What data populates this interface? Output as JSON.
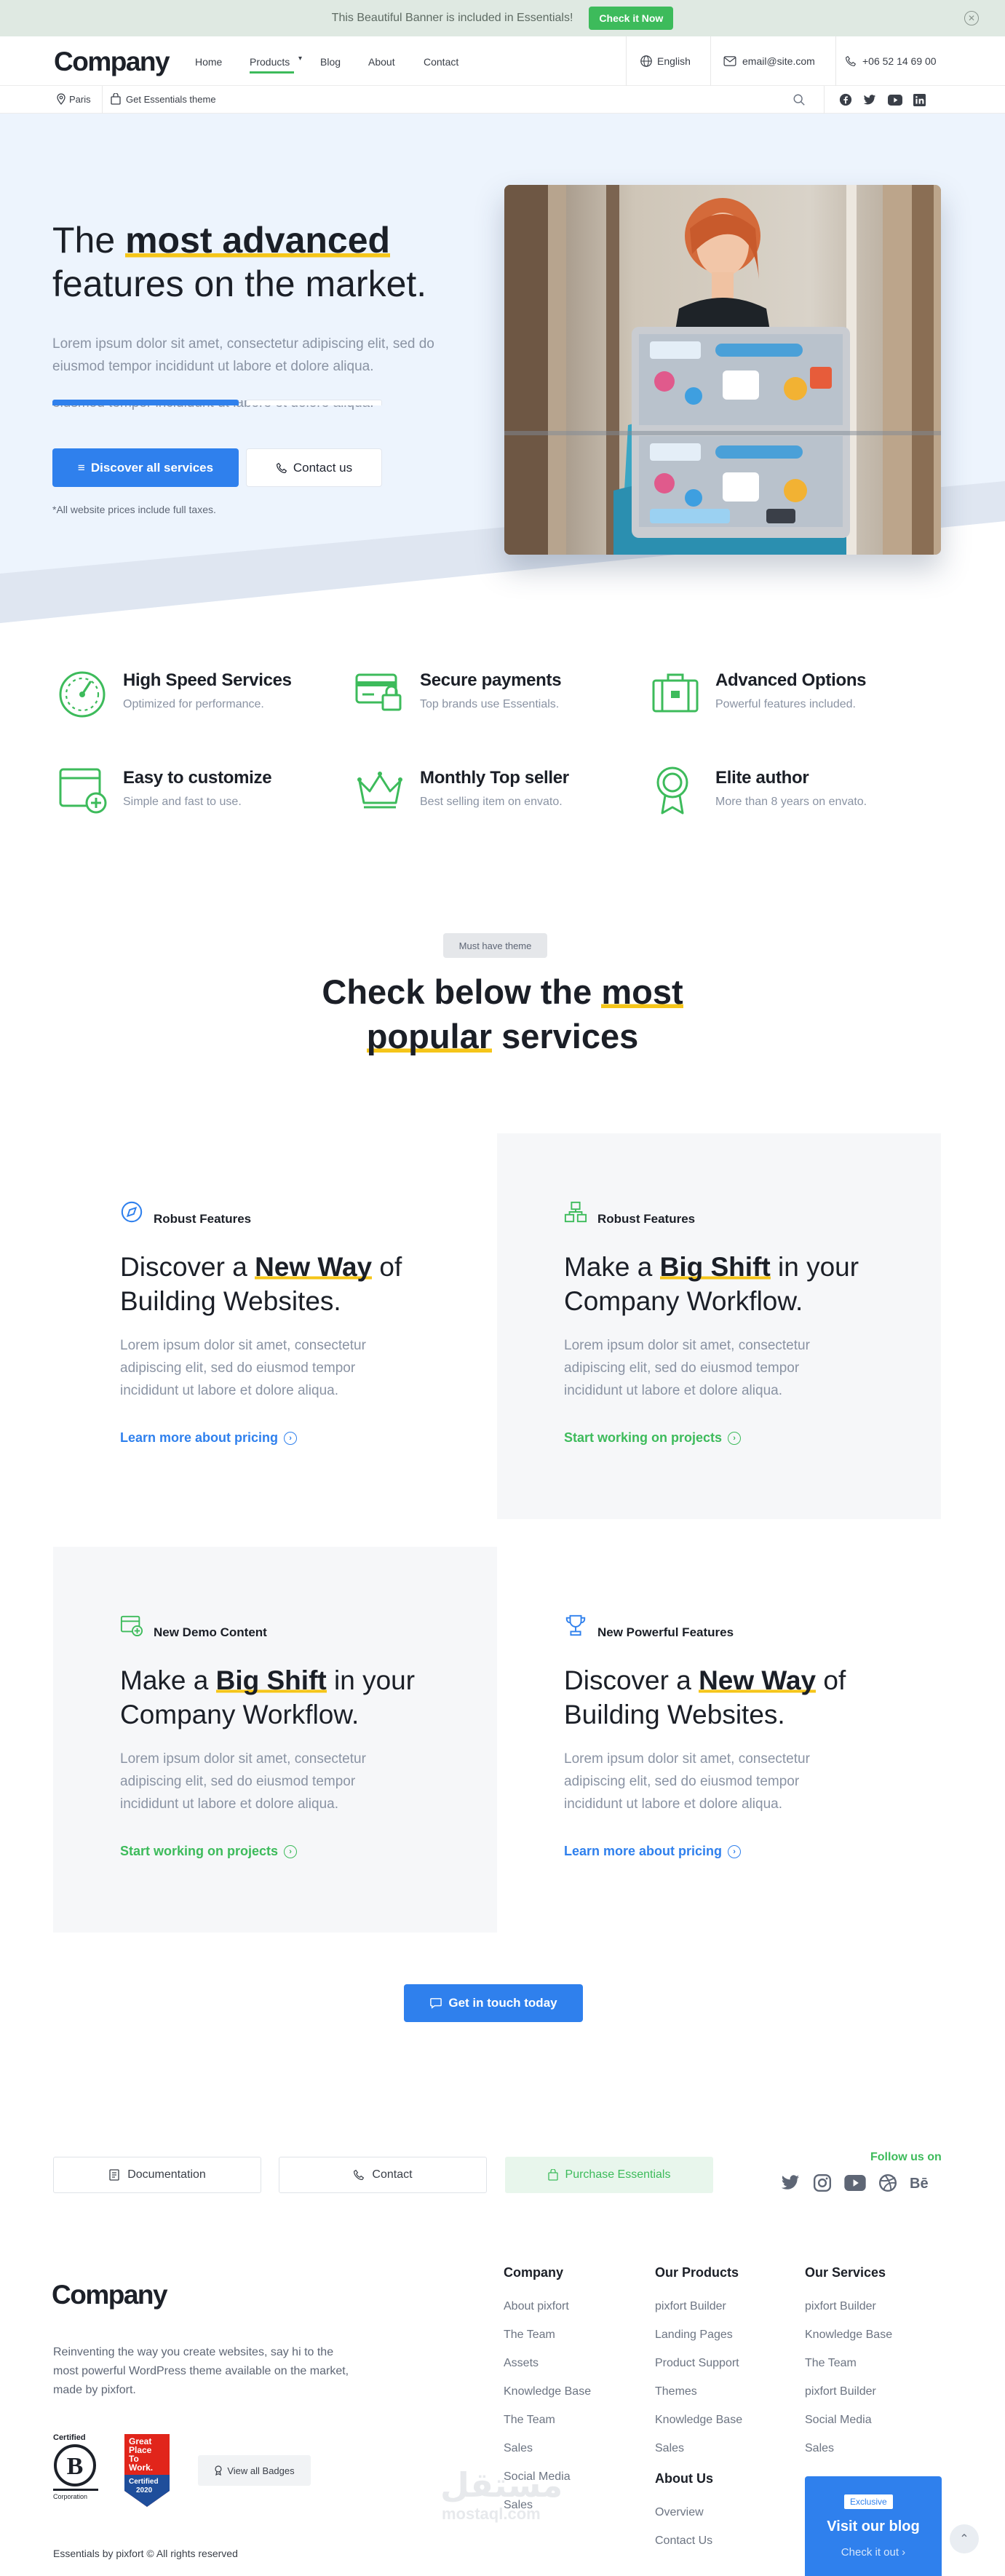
{
  "banner": {
    "text": "This Beautiful Banner is included in Essentials!",
    "cta": "Check it Now"
  },
  "brand": {
    "logo": "Company",
    "primary_color": "#2f80ed",
    "accent_green": "#3dbb5b",
    "highlight_yellow": "#f5c518"
  },
  "nav": {
    "home": "Home",
    "products": "Products",
    "blog": "Blog",
    "about": "About",
    "contact": "Contact"
  },
  "header": {
    "language": "English",
    "email": "email@site.com",
    "phone": "+06 52 14 69 00"
  },
  "subbar": {
    "location": "Paris",
    "theme": "Get Essentials theme"
  },
  "hero": {
    "title_pre": "The ",
    "title_highlight": "most advanced",
    "title_post": "features on the market.",
    "desc": "Lorem ipsum dolor sit amet, consectetur adipiscing elit, sed do eiusmod tempor incididunt ut labore et dolore aliqua.",
    "ghost_text": "eiusmod tempor incididunt ut labore et dolore aliqua.",
    "btn_primary": "Discover all services",
    "btn_secondary": "Contact us",
    "note": "*All website prices include full taxes."
  },
  "features": [
    {
      "title": "High Speed Services",
      "sub": "Optimized for performance.",
      "icon": "speedometer-icon"
    },
    {
      "title": "Secure payments",
      "sub": "Top brands use Essentials.",
      "icon": "credit-card-lock-icon"
    },
    {
      "title": "Advanced Options",
      "sub": "Powerful features included.",
      "icon": "toolbox-icon"
    },
    {
      "title": "Easy to customize",
      "sub": "Simple and fast to use.",
      "icon": "window-add-icon"
    },
    {
      "title": "Monthly Top seller",
      "sub": "Best selling item on envato.",
      "icon": "crown-icon"
    },
    {
      "title": "Elite author",
      "sub": "More than 8 years on envato.",
      "icon": "award-badge-icon"
    }
  ],
  "section": {
    "tag": "Must have theme",
    "title_pre": "Check below the ",
    "title_hl1": "most",
    "title_hl2": "popular",
    "title_post": " services"
  },
  "cards": [
    {
      "label": "Robust Features",
      "title_pre": "Discover a ",
      "title_hl": "New Way",
      "title_post": " of Building Websites.",
      "desc": "Lorem ipsum dolor sit amet, consectetur adipiscing elit, sed do eiusmod tempor incididunt ut labore et dolore aliqua.",
      "link": "Learn more about pricing",
      "link_color": "#2f80ed",
      "icon": "compass-icon"
    },
    {
      "label": "Robust Features",
      "title_pre": "Make a ",
      "title_hl": "Big Shift",
      "title_post": " in your Company Workflow.",
      "desc": "Lorem ipsum dolor sit amet, consectetur adipiscing elit, sed do eiusmod tempor incididunt ut labore et dolore aliqua.",
      "link": "Start working on projects",
      "link_color": "#3dbb5b",
      "icon": "hierarchy-icon"
    },
    {
      "label": "New Demo Content",
      "title_pre": "Make a ",
      "title_hl": "Big Shift",
      "title_post": " in your Company Workflow.",
      "desc": "Lorem ipsum dolor sit amet, consectetur adipiscing elit, sed do eiusmod tempor incididunt ut labore et dolore aliqua.",
      "link": "Start working on projects",
      "link_color": "#3dbb5b",
      "icon": "calendar-add-icon"
    },
    {
      "label": "New Powerful Features",
      "title_pre": "Discover a ",
      "title_hl": "New Way",
      "title_post": " of Building Websites.",
      "desc": "Lorem ipsum dolor sit amet, consectetur adipiscing elit, sed do eiusmod tempor incididunt ut labore et dolore aliqua.",
      "link": "Learn more about pricing",
      "link_color": "#2f80ed",
      "icon": "trophy-icon"
    }
  ],
  "cta": "Get in touch today",
  "footer": {
    "btn_docs": "Documentation",
    "btn_contact": "Contact",
    "btn_purchase": "Purchase Essentials",
    "follow": "Follow us on",
    "logo": "Company",
    "about": "Reinventing the way you create websites, say hi to the most powerful WordPress theme available on the market, made by pixfort.",
    "badge_bcorp_top": "Certified",
    "badge_bcorp_bottom": "Corporation",
    "badge_gptw_lines": [
      "Great",
      "Place",
      "To",
      "Work.",
      "Certified",
      "2020"
    ],
    "view_badges": "View all Badges",
    "copyright": "Essentials by pixfort © All rights reserved",
    "col1_title": "Company",
    "col1": [
      "About pixfort",
      "The Team",
      "Assets",
      "Knowledge Base",
      "The Team",
      "Sales",
      "Social Media",
      "Sales"
    ],
    "col2_title": "Our Products",
    "col2": [
      "pixfort Builder",
      "Landing Pages",
      "Product Support",
      "Themes",
      "Knowledge Base",
      "Sales"
    ],
    "col2b_title": "About Us",
    "col2b": [
      "Overview",
      "Contact Us"
    ],
    "col3_title": "Our Services",
    "col3": [
      "pixfort Builder",
      "Knowledge Base",
      "The Team",
      "pixfort Builder",
      "Social Media",
      "Sales"
    ],
    "blog_badge": "Exclusive",
    "blog_title": "Visit our blog",
    "blog_link": "Check it out",
    "watermark_ar": "مستقل",
    "watermark_en": "mostaql.com"
  }
}
